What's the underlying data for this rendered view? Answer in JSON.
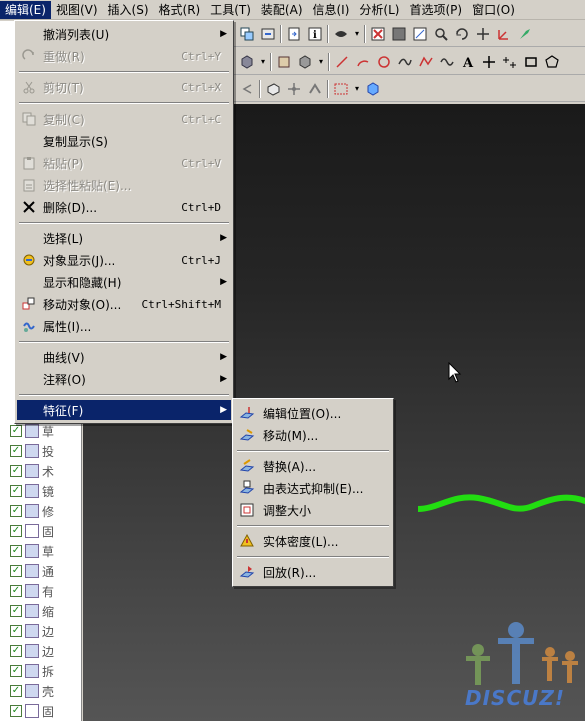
{
  "menubar": {
    "items": [
      {
        "label": "编辑(E)",
        "active": true
      },
      {
        "label": "视图(V)",
        "active": false
      },
      {
        "label": "插入(S)",
        "active": false
      },
      {
        "label": "格式(R)",
        "active": false
      },
      {
        "label": "工具(T)",
        "active": false
      },
      {
        "label": "装配(A)",
        "active": false
      },
      {
        "label": "信息(I)",
        "active": false
      },
      {
        "label": "分析(L)",
        "active": false
      },
      {
        "label": "首选项(P)",
        "active": false
      },
      {
        "label": "窗口(O)",
        "active": false
      }
    ]
  },
  "edit_menu": {
    "items": [
      {
        "label": "撤消列表(U)",
        "shortcut": "",
        "submenu": true,
        "disabled": false,
        "icon": ""
      },
      {
        "label": "重做(R)",
        "shortcut": "Ctrl+Y",
        "submenu": false,
        "disabled": true,
        "icon": "redo-icon"
      },
      {
        "label": "剪切(T)",
        "shortcut": "Ctrl+X",
        "submenu": false,
        "disabled": true,
        "icon": "cut-icon"
      },
      {
        "label": "复制(C)",
        "shortcut": "Ctrl+C",
        "submenu": false,
        "disabled": true,
        "icon": "copy-icon"
      },
      {
        "label": "复制显示(S)",
        "shortcut": "",
        "submenu": false,
        "disabled": false,
        "icon": ""
      },
      {
        "label": "粘贴(P)",
        "shortcut": "Ctrl+V",
        "submenu": false,
        "disabled": true,
        "icon": "paste-icon"
      },
      {
        "label": "选择性粘贴(E)...",
        "shortcut": "",
        "submenu": false,
        "disabled": true,
        "icon": "paste-special-icon"
      },
      {
        "label": "删除(D)...",
        "shortcut": "Ctrl+D",
        "submenu": false,
        "disabled": false,
        "icon": "delete-icon"
      },
      {
        "label": "选择(L)",
        "shortcut": "",
        "submenu": true,
        "disabled": false,
        "icon": ""
      },
      {
        "label": "对象显示(J)...",
        "shortcut": "Ctrl+J",
        "submenu": false,
        "disabled": false,
        "icon": "object-display-icon"
      },
      {
        "label": "显示和隐藏(H)",
        "shortcut": "",
        "submenu": true,
        "disabled": false,
        "icon": ""
      },
      {
        "label": "移动对象(O)...",
        "shortcut": "Ctrl+Shift+M",
        "submenu": false,
        "disabled": false,
        "icon": "move-object-icon"
      },
      {
        "label": "属性(I)...",
        "shortcut": "",
        "submenu": false,
        "disabled": false,
        "icon": "properties-icon"
      },
      {
        "label": "曲线(V)",
        "shortcut": "",
        "submenu": true,
        "disabled": false,
        "icon": ""
      },
      {
        "label": "注释(O)",
        "shortcut": "",
        "submenu": true,
        "disabled": false,
        "icon": ""
      },
      {
        "label": "特征(F)",
        "shortcut": "",
        "submenu": true,
        "disabled": false,
        "icon": ""
      }
    ]
  },
  "feature_submenu": {
    "items": [
      {
        "label": "编辑位置(O)...",
        "icon": "edit-position-icon"
      },
      {
        "label": "移动(M)...",
        "icon": "move-feature-icon"
      },
      {
        "label": "替换(A)...",
        "icon": "replace-icon"
      },
      {
        "label": "由表达式抑制(E)...",
        "icon": "suppress-by-expression-icon"
      },
      {
        "label": "调整大小",
        "icon": "resize-icon"
      },
      {
        "label": "实体密度(L)...",
        "icon": "solid-density-icon"
      },
      {
        "label": "回放(R)...",
        "icon": "playback-icon"
      }
    ]
  },
  "navigator": {
    "labels": [
      "草",
      "投",
      "术",
      "镜",
      "修",
      "固",
      "草",
      "通",
      "有",
      "缩",
      "边",
      "边",
      "拆",
      "壳",
      "固"
    ]
  },
  "watermark": {
    "text": "DISCUZ!"
  },
  "colors": {
    "highlight": "#0a246a",
    "menu_bg": "#d4d0c8",
    "curve": "#22dd11",
    "watermark": "#4a78c8"
  }
}
